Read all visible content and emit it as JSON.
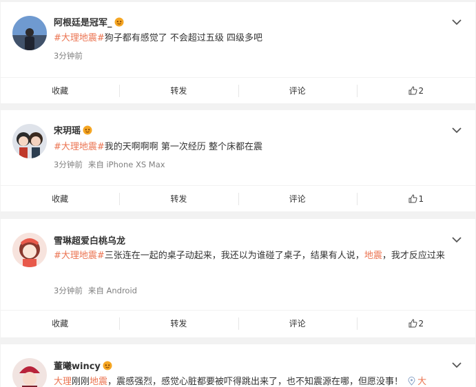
{
  "posts": [
    {
      "user": "阿根廷是冠军_",
      "topic": "#大理地震#",
      "text": "狗子都有感觉了 不会超过五级 四级多吧",
      "time": "3分钟前",
      "source": "",
      "actions": {
        "fav": "收藏",
        "repost": "转发",
        "comment": "评论",
        "like": "2"
      }
    },
    {
      "user": "宋玥瑶",
      "topic": "#大理地震#",
      "text": "我的天啊啊啊 第一次经历 整个床都在震",
      "time": "3分钟前",
      "source": "来自 iPhone XS Max",
      "actions": {
        "fav": "收藏",
        "repost": "转发",
        "comment": "评论",
        "like": "1"
      }
    },
    {
      "user": "雪琳超爱白桃乌龙",
      "topic": "#大理地震#",
      "text_a": "三张连在一起的桌子动起来，我还以为谁碰了桌子，结果有人说，",
      "text_link": "地震",
      "text_b": "，我才反应过来",
      "time": "3分钟前",
      "source": "来自 Android",
      "actions": {
        "fav": "收藏",
        "repost": "转发",
        "comment": "评论",
        "like": "2"
      }
    },
    {
      "user": "董曦wincy",
      "link_a": "大理",
      "text_a": "刚刚",
      "link_b": "地震",
      "text_b": "，震感强烈，感觉心脏都要被吓得跳出来了，也不知震源在哪，但愿没事！",
      "location": "大"
    }
  ],
  "colors": {
    "accent": "#eb7350",
    "meta": "#808080",
    "bg": "#f2f2f2"
  }
}
